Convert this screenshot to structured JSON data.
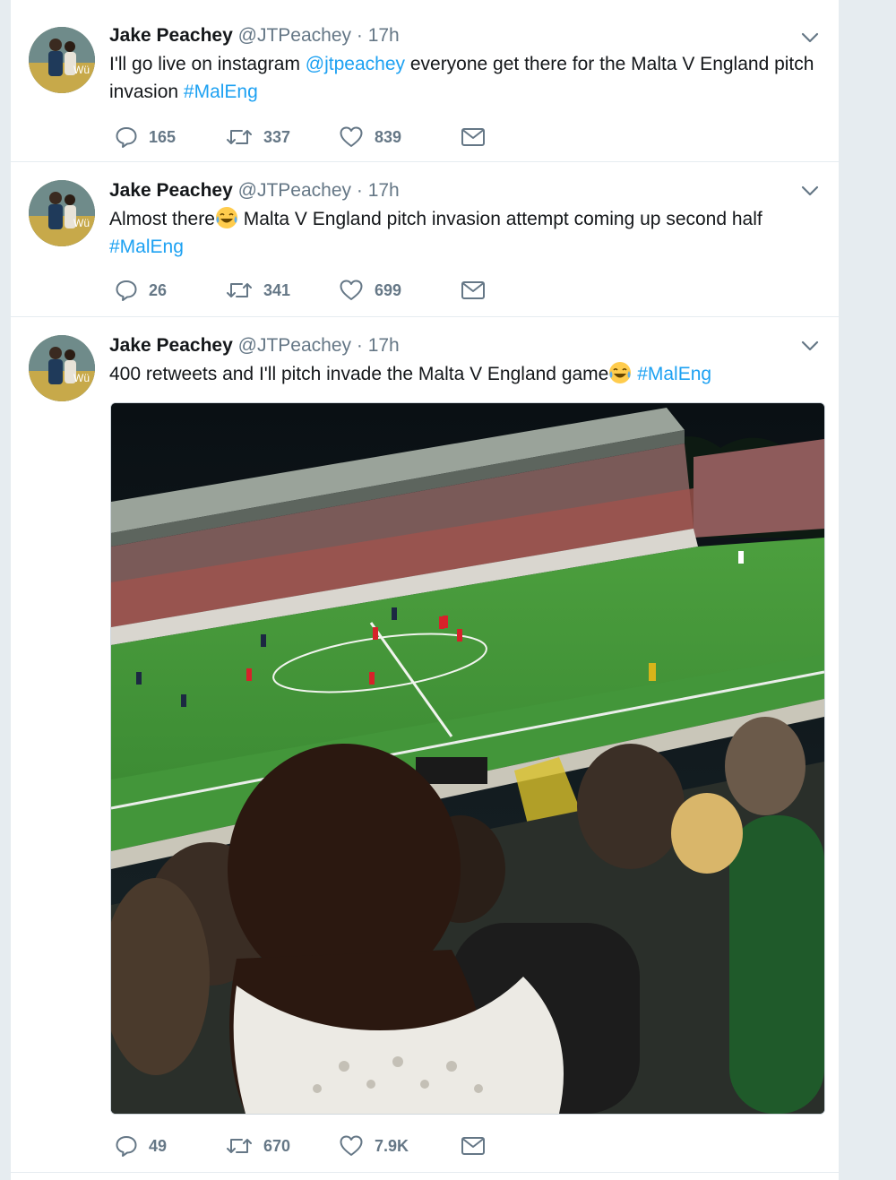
{
  "tweets": [
    {
      "name": "Jake Peachey",
      "handle": "@JTPeachey",
      "dot": "·",
      "time": "17h",
      "text_parts": [
        "I'll go live on instagram ",
        "@jtpeachey",
        " everyone get there for the Malta V England pitch invasion ",
        "#MalEng"
      ],
      "replies": "165",
      "retweets": "337",
      "likes": "839"
    },
    {
      "name": "Jake Peachey",
      "handle": "@JTPeachey",
      "dot": "·",
      "time": "17h",
      "text_parts": [
        "Almost there",
        " Malta V England pitch invasion attempt coming up second half ",
        "#MalEng"
      ],
      "emoji": "face-with-tears-of-joy",
      "replies": "26",
      "retweets": "341",
      "likes": "699"
    },
    {
      "name": "Jake Peachey",
      "handle": "@JTPeachey",
      "dot": "·",
      "time": "17h",
      "text_parts": [
        "400 retweets and I'll pitch invade the Malta V England game",
        " ",
        "#MalEng"
      ],
      "emoji": "face-with-tears-of-joy",
      "replies": "49",
      "retweets": "670",
      "likes": "7.9K",
      "media": "stadium-crowd-photo"
    }
  ],
  "colors": {
    "link": "#1da1f2",
    "meta": "#657786",
    "pitch": "#3f9a3a"
  },
  "icons": [
    "reply-icon",
    "retweet-icon",
    "like-icon",
    "dm-icon",
    "chevron-down-icon"
  ]
}
